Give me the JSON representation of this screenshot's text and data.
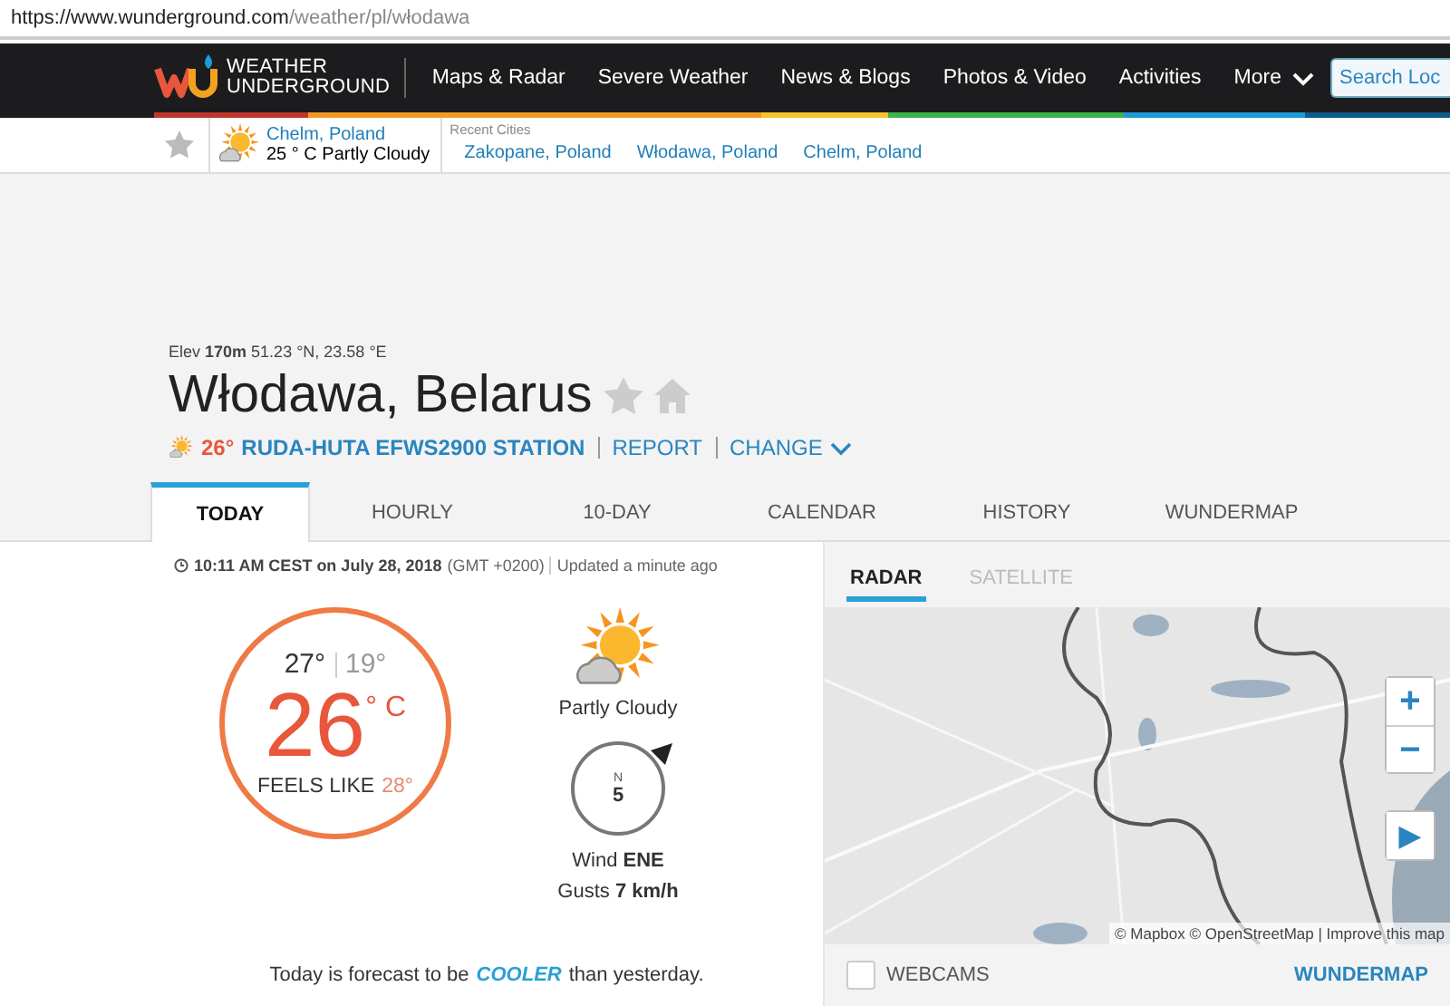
{
  "url": {
    "host": "https://www.wunderground.com",
    "path": "/weather/pl/włodawa"
  },
  "nav": {
    "logo_top": "WEATHER",
    "logo_bottom": "UNDERGROUND",
    "items": [
      "Maps & Radar",
      "Severe Weather",
      "News & Blogs",
      "Photos & Video",
      "Activities"
    ],
    "more": "More",
    "search": {
      "placeholder": "Search Loc"
    }
  },
  "favorites": {
    "city": "Chelm, Poland",
    "conditions": "25 ° C Partly Cloudy",
    "recent_label": "Recent Cities",
    "recent": [
      "Zakopane, Poland",
      "Włodawa, Poland",
      "Chelm, Poland"
    ]
  },
  "header": {
    "elevation": "Elev **170m** 51.23 °N, 23.58 °E",
    "city": "Włodawa, Belarus",
    "station_temp": "26°",
    "station": "RUDA-HUTA EFWS2900 STATION",
    "report": "REPORT",
    "change": "CHANGE"
  },
  "tabs": [
    {
      "label": "TODAY",
      "selected": true
    },
    {
      "label": "HOURLY",
      "selected": false
    },
    {
      "label": "10-DAY",
      "selected": false
    },
    {
      "label": "CALENDAR",
      "selected": false
    },
    {
      "label": "HISTORY",
      "selected": false
    },
    {
      "label": "WUNDERMAP",
      "selected": false
    }
  ],
  "current": {
    "time": "10:11 AM CEST on July 28, 2018",
    "timezone": "(GMT +0200)",
    "updated": "Updated a minute ago",
    "high": "27°",
    "low": "19°",
    "temp": "26",
    "unit": "° C",
    "feels_label": "FEELS LIKE",
    "feels": "28°",
    "condition": "Partly Cloudy",
    "compass_label": "N",
    "wind_speed": "5",
    "wind": "Wind **ENE**",
    "gusts": "Gusts **7 km/h**",
    "forecast_before": "Today is forecast to be",
    "forecast_highlight": "COOLER",
    "forecast_after": "than yesterday."
  },
  "map": {
    "tabs": [
      {
        "label": "RADAR",
        "selected": true
      },
      {
        "label": "SATELLITE",
        "selected": false
      }
    ],
    "controls": [
      "+",
      "−",
      "▶"
    ],
    "attribution": "© Mapbox © OpenStreetMap | Improve this map",
    "webcams": {
      "label": "WEBCAMS",
      "checked": false
    },
    "link": "WUNDERMAP"
  }
}
